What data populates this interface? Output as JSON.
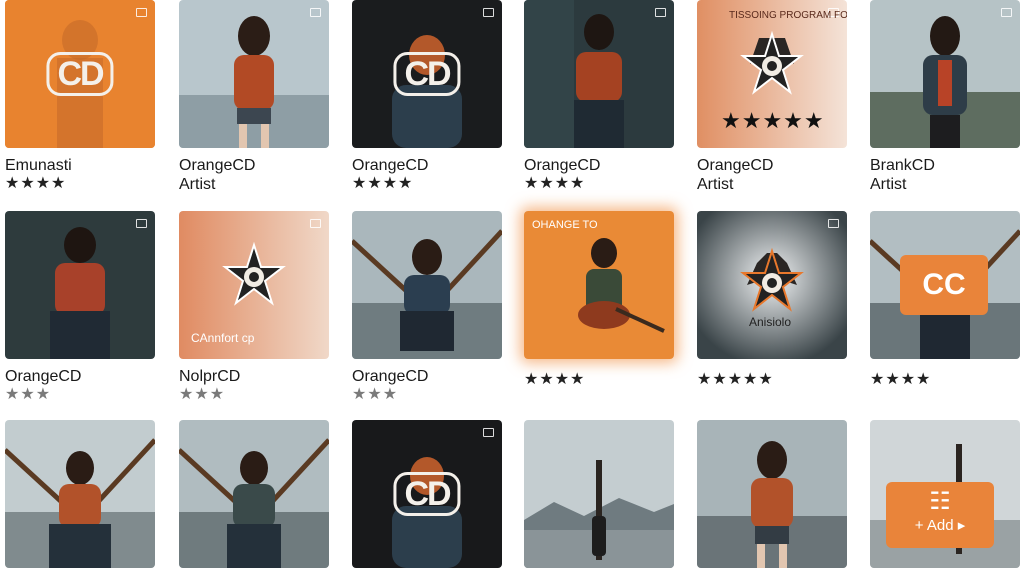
{
  "colors": {
    "accent": "#e9843a",
    "background": "#ffffff"
  },
  "tiles": [
    {
      "title": "Emunasti",
      "subtitle": "",
      "rating": "★★★★",
      "cover_text": "CD"
    },
    {
      "title": "OrangeCD",
      "subtitle": "Artist",
      "rating": ""
    },
    {
      "title": "OrangeCD",
      "subtitle": "",
      "rating": "★★★★",
      "cover_text": "CD"
    },
    {
      "title": "OrangeCD",
      "subtitle": "",
      "rating": "★★★★"
    },
    {
      "title": "OrangeCD",
      "subtitle": "Artist",
      "rating": "",
      "cover_rating": "★★★★★",
      "cover_text": "TISSOING PROGRAM FOR THIS"
    },
    {
      "title": "BrankCD",
      "subtitle": "Artist",
      "rating": ""
    },
    {
      "title": "OrangeCD",
      "subtitle": "",
      "rating": "★★★"
    },
    {
      "title": "NolprCD",
      "subtitle": "",
      "rating": "★★★",
      "cover_text": "CAnnfort cp"
    },
    {
      "title": "OrangeCD",
      "subtitle": "",
      "rating": "★★★"
    },
    {
      "title": "",
      "subtitle": "",
      "rating": "★★★★",
      "cover_text": "OHANGE TO"
    },
    {
      "title": "",
      "subtitle": "",
      "rating": "★★★★★",
      "cover_text": "Anisiolo"
    },
    {
      "title": "",
      "subtitle": "",
      "rating": "★★★★",
      "cover_text": "CC"
    },
    {
      "title": "",
      "subtitle": "",
      "rating": ""
    },
    {
      "title": "",
      "subtitle": "",
      "rating": ""
    },
    {
      "title": "",
      "subtitle": "",
      "rating": "",
      "cover_text": "CD"
    },
    {
      "title": "",
      "subtitle": "",
      "rating": ""
    },
    {
      "title": "",
      "subtitle": "",
      "rating": ""
    },
    {
      "title": "",
      "subtitle": "",
      "rating": "",
      "add_icon": "☷",
      "add_label": "+ Add ▸"
    }
  ]
}
